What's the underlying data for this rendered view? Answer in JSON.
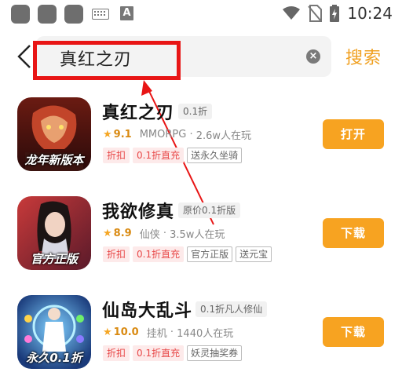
{
  "status_bar": {
    "time": "10:24",
    "icons": [
      "app-icon",
      "app-icon",
      "app-icon",
      "keyboard-icon",
      "a-icon",
      "wifi-icon",
      "no-sim-icon",
      "battery-charging-icon"
    ]
  },
  "search": {
    "query": "真红之刃",
    "search_button": "搜索"
  },
  "games": [
    {
      "name": "真红之刃",
      "discount": "0.1折",
      "rating": "9.1",
      "genre": "MMORPG",
      "players": "2.6w人在玩",
      "tags_red": [
        "折扣",
        "0.1折直充"
      ],
      "tags_outline": [
        "送永久坐骑"
      ],
      "icon_caption": "龙年新版本",
      "action": "打开"
    },
    {
      "name": "我欲修真",
      "discount": "原价0.1折版",
      "rating": "8.9",
      "genre": "仙侠",
      "players": "3.5w人在玩",
      "tags_red": [
        "折扣",
        "0.1折直充"
      ],
      "tags_outline": [
        "官方正版",
        "送元宝"
      ],
      "icon_caption": "官方正版",
      "action": "下载"
    },
    {
      "name": "仙岛大乱斗",
      "discount": "0.1折凡人修仙",
      "rating": "10.0",
      "genre": "挂机",
      "players": "1440人在玩",
      "tags_red": [
        "折扣",
        "0.1折直充"
      ],
      "tags_outline": [
        "妖灵抽奖券"
      ],
      "icon_caption": "永久0.1折",
      "action": "下载"
    }
  ],
  "colors": {
    "accent": "#f7a321",
    "highlight": "#e81515"
  }
}
